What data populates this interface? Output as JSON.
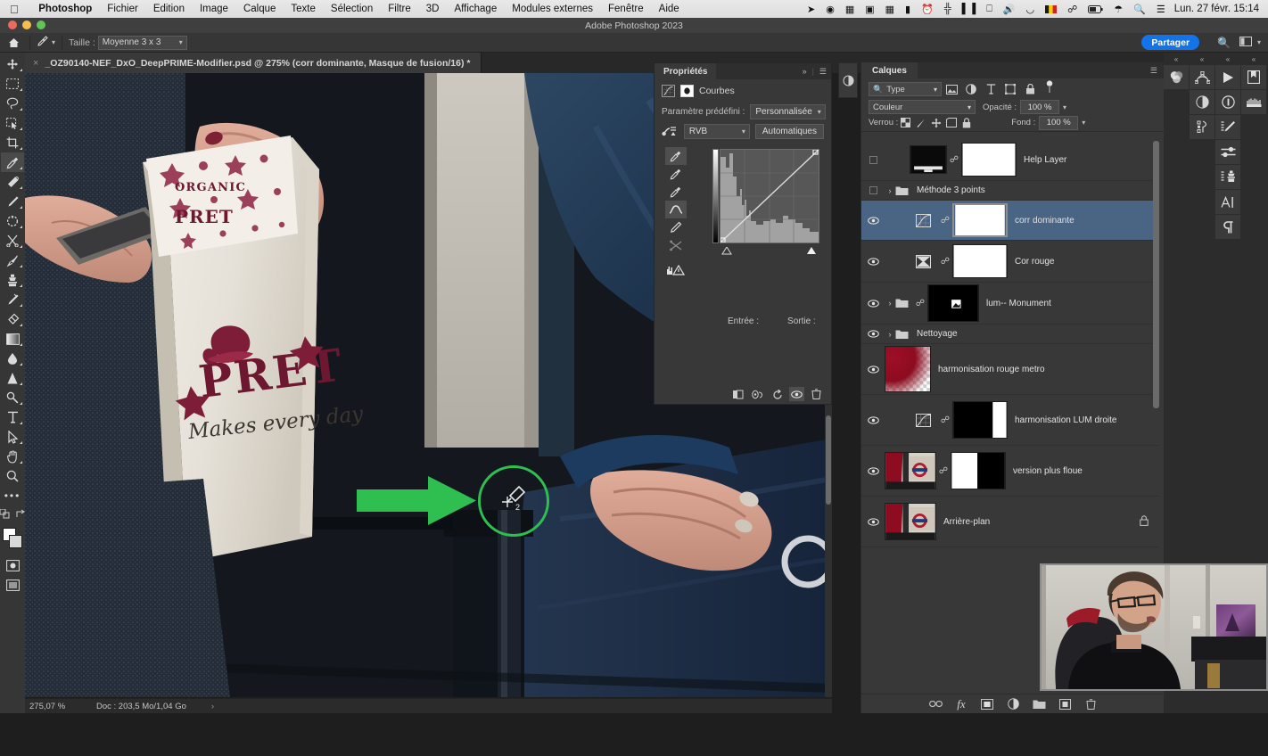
{
  "macbar": {
    "apple_icon": "apple-icon",
    "menus": [
      {
        "label": "Photoshop",
        "bold": true
      },
      {
        "label": "Fichier",
        "bold": false
      },
      {
        "label": "Edition",
        "bold": false
      },
      {
        "label": "Image",
        "bold": false
      },
      {
        "label": "Calque",
        "bold": false
      },
      {
        "label": "Texte",
        "bold": false
      },
      {
        "label": "Sélection",
        "bold": false
      },
      {
        "label": "Filtre",
        "bold": false
      },
      {
        "label": "3D",
        "bold": false
      },
      {
        "label": "Affichage",
        "bold": false
      },
      {
        "label": "Modules externes",
        "bold": false
      },
      {
        "label": "Fenêtre",
        "bold": false
      },
      {
        "label": "Aide",
        "bold": false
      }
    ],
    "status_icons": [
      "bird-icon",
      "creative-cloud-icon",
      "shortcuts-icon",
      "screen-record-icon",
      "airplay-icon",
      "battery-menu-icon",
      "time-machine-icon",
      "binoculars-icon",
      "stats-icon",
      "display-icon",
      "volume-icon",
      "cleaner-icon",
      "belgium-flag-icon",
      "bluetooth-icon",
      "battery-icon",
      "wifi-icon",
      "search-icon",
      "control-center-icon"
    ],
    "clock": "Lun. 27 févr.  15:14"
  },
  "titlebar": {
    "title": "Adobe Photoshop 2023"
  },
  "optionsbar": {
    "home_icon": "home-icon",
    "tool_icon": "eyedropper-icon",
    "size_label": "Taille :",
    "size_value": "Moyenne 3 x 3",
    "share_label": "Partager",
    "search_icon": "search-icon",
    "workspace_icon": "workspace-icon"
  },
  "tabbar": {
    "close_icon": "close-icon",
    "document_title": "_OZ90140-NEF_DxO_DeepPRIME-Modifier.psd @ 275% (corr dominante, Masque de fusion/16) *"
  },
  "lefttoolbar": {
    "tools": [
      {
        "name": "move-tool",
        "icon": "move-icon"
      },
      {
        "name": "marquee-tool",
        "icon": "marquee-icon"
      },
      {
        "name": "lasso-tool",
        "icon": "lasso-icon"
      },
      {
        "name": "object-selection-tool",
        "icon": "object-selection-icon"
      },
      {
        "name": "crop-tool",
        "icon": "crop-icon"
      },
      {
        "name": "eyedropper-tool",
        "icon": "eyedropper-icon",
        "selected": true
      },
      {
        "name": "spot-healing-tool",
        "icon": "healing-icon"
      },
      {
        "name": "brush-tool",
        "icon": "brush-icon"
      },
      {
        "name": "clone-stamp-tool",
        "icon": "stamp-icon"
      },
      {
        "name": "history-brush-tool",
        "icon": "history-brush-icon"
      },
      {
        "name": "eraser-tool",
        "icon": "eraser-icon"
      },
      {
        "name": "gradient-tool",
        "icon": "gradient-icon"
      },
      {
        "name": "blur-tool",
        "icon": "blur-icon"
      },
      {
        "name": "dodge-tool",
        "icon": "dodge-icon"
      },
      {
        "name": "pen-tool",
        "icon": "pen-icon"
      },
      {
        "name": "type-tool",
        "icon": "type-icon"
      },
      {
        "name": "path-selection-tool",
        "icon": "path-selection-icon"
      },
      {
        "name": "shape-tool",
        "icon": "shape-icon"
      },
      {
        "name": "hand-tool",
        "icon": "hand-icon"
      },
      {
        "name": "zoom-tool",
        "icon": "zoom-icon"
      },
      {
        "name": "more-tools",
        "icon": "ellipsis-icon"
      }
    ],
    "quickmask_icon": "quick-mask-icon",
    "screenmode_icon": "screen-mode-icon"
  },
  "properties": {
    "tab_label": "Propriétés",
    "collapse_icon": "chevrons-right-icon",
    "menu_icon": "panel-menu-icon",
    "adjustment_icon": "curves-adjustment-icon",
    "mask_icon": "layer-mask-icon",
    "title": "Courbes",
    "preset_label": "Paramètre prédéfini :",
    "preset_value": "Personnalisée",
    "channel_icon": "on-image-adjust-icon",
    "channel_value": "RVB",
    "auto_label": "Automatiques",
    "eyedroppers": [
      {
        "name": "set-black-point-eyedropper",
        "selected": true
      },
      {
        "name": "set-gray-point-eyedropper",
        "selected": false
      },
      {
        "name": "set-white-point-eyedropper",
        "selected": false
      },
      {
        "name": "curve-point-tool",
        "selected": true
      },
      {
        "name": "pencil-draw-tool",
        "selected": false
      },
      {
        "name": "smooth-curve-tool",
        "selected": false
      },
      {
        "name": "histogram-warning-icon",
        "selected": false
      }
    ],
    "input_label": "Entrée :",
    "output_label": "Sortie :",
    "footer_buttons": [
      {
        "name": "clip-to-layer-button",
        "icon": "clip-to-layer-icon"
      },
      {
        "name": "toggle-previous-state-button",
        "icon": "previous-state-icon"
      },
      {
        "name": "reset-button",
        "icon": "reset-icon"
      },
      {
        "name": "visibility-button",
        "icon": "eye-icon"
      },
      {
        "name": "delete-button",
        "icon": "trash-icon"
      }
    ]
  },
  "layers": {
    "tab_label": "Calques",
    "menu_icon": "panel-menu-icon",
    "filter_icon": "search-icon",
    "filter_value": "Type",
    "filter_buttons": [
      "pixel-filter-icon",
      "adjustment-filter-icon",
      "type-filter-icon",
      "shape-filter-icon",
      "smart-object-filter-icon"
    ],
    "filter_toggle": "filter-toggle-icon",
    "blend_mode": "Couleur",
    "opacity_label": "Opacité :",
    "opacity_value": "100 %",
    "lock_label": "Verrou :",
    "lock_icons": [
      "lock-transparency-icon",
      "lock-pixels-icon",
      "lock-position-icon",
      "lock-artboard-icon",
      "lock-all-icon"
    ],
    "fill_label": "Fond :",
    "fill_value": "100 %",
    "items": [
      {
        "name": "Help Layer",
        "visible": false,
        "type": "layer",
        "has_link": true,
        "has_mask": true,
        "thumb": "black-screen",
        "locked": false,
        "selected": false
      },
      {
        "name": "Méthode 3 points",
        "visible": false,
        "type": "group",
        "has_link": false,
        "has_mask": false,
        "locked": false,
        "selected": false
      },
      {
        "name": "corr dominante",
        "visible": true,
        "type": "adjustment",
        "has_link": true,
        "has_mask": true,
        "thumb": "curves",
        "locked": false,
        "selected": true
      },
      {
        "name": "Cor rouge",
        "visible": true,
        "type": "adjustment",
        "has_link": true,
        "has_mask": true,
        "thumb": "channel-mixer",
        "locked": false,
        "selected": false
      },
      {
        "name": "lum-- Monument",
        "visible": true,
        "type": "group",
        "has_link": true,
        "has_mask": true,
        "thumb": "black-mask",
        "locked": false,
        "selected": false
      },
      {
        "name": "Nettoyage",
        "visible": true,
        "type": "group",
        "has_link": false,
        "has_mask": false,
        "locked": false,
        "selected": false
      },
      {
        "name": "harmonisation rouge metro",
        "visible": true,
        "type": "layer",
        "has_link": false,
        "has_mask": false,
        "thumb": "red-gradient",
        "locked": false,
        "selected": false
      },
      {
        "name": "harmonisation LUM droite",
        "visible": true,
        "type": "adjustment",
        "has_link": true,
        "has_mask": true,
        "thumb": "curves",
        "locked": false,
        "selected": false
      },
      {
        "name": "version plus floue",
        "visible": true,
        "type": "layer",
        "has_link": true,
        "has_mask": true,
        "thumb": "photo",
        "locked": false,
        "selected": false
      },
      {
        "name": "Arrière-plan",
        "visible": true,
        "type": "layer",
        "has_link": false,
        "has_mask": false,
        "thumb": "photo",
        "locked": true,
        "selected": false
      }
    ],
    "footer_buttons": [
      {
        "name": "link-layers-button",
        "icon": "link-icon"
      },
      {
        "name": "layer-style-button",
        "icon": "fx-icon"
      },
      {
        "name": "add-mask-button",
        "icon": "mask-icon"
      },
      {
        "name": "new-adjustment-button",
        "icon": "half-circle-icon"
      },
      {
        "name": "new-group-button",
        "icon": "folder-icon"
      },
      {
        "name": "new-layer-button",
        "icon": "new-layer-icon"
      },
      {
        "name": "delete-layer-button",
        "icon": "trash-icon"
      }
    ]
  },
  "rightdock": {
    "columns": [
      {
        "icons": [
          "color-wheel-icon"
        ]
      },
      {
        "icons": [
          "paths-icon",
          "adjustments-icon",
          "histogram-icon"
        ]
      },
      {
        "icons": [
          "play-icon",
          "info-icon",
          "brush-settings-icon",
          "sliders-icon",
          "clone-source-icon",
          "character-icon",
          "paragraph-icon"
        ]
      },
      {
        "icons": [
          "libraries-icon",
          "brushes-icon"
        ]
      }
    ]
  },
  "statusbar": {
    "zoom": "275,07 %",
    "doc_info": "Doc : 203,5 Mo/1,04 Go",
    "arrow_icon": "chevron-right-icon"
  },
  "annotations": {
    "arrow_color": "#2fbf50",
    "circle_color": "#2fbf50",
    "arrow_name": "green-pointer-arrow",
    "circle_name": "green-highlight-circle"
  },
  "canvas": {
    "bag_text_main": "PRET",
    "bag_text_sub": "Makes every day",
    "bag_text_top": "ORGANIC",
    "bag_text_top2": "PRET"
  },
  "webcam": {
    "label": "webcam-overlay"
  },
  "colors": {
    "accent_blue": "#1473e6",
    "selection_blue": "#4a6484",
    "panel_bg": "#383838",
    "green": "#2fbf50"
  }
}
